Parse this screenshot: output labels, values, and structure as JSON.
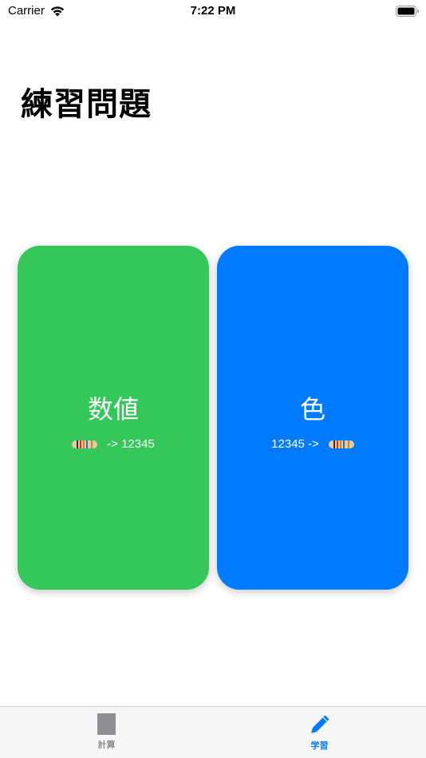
{
  "status_bar": {
    "carrier": "Carrier",
    "time": "7:22 PM"
  },
  "page": {
    "title": "練習問題"
  },
  "cards": [
    {
      "title": "数値",
      "subtitle": "-> 12345",
      "color": "#34C759",
      "icon": "resistor-icon"
    },
    {
      "title": "色",
      "subtitle": "12345 ->",
      "color": "#007AFF",
      "icon": "resistor-icon"
    }
  ],
  "tab_bar": {
    "tabs": [
      {
        "label": "計算",
        "icon": "calculator-icon",
        "active": false
      },
      {
        "label": "学習",
        "icon": "pencil-icon",
        "active": true
      }
    ]
  },
  "colors": {
    "accent": "#007AFF",
    "green": "#34C759",
    "inactive": "#8E8E93"
  }
}
